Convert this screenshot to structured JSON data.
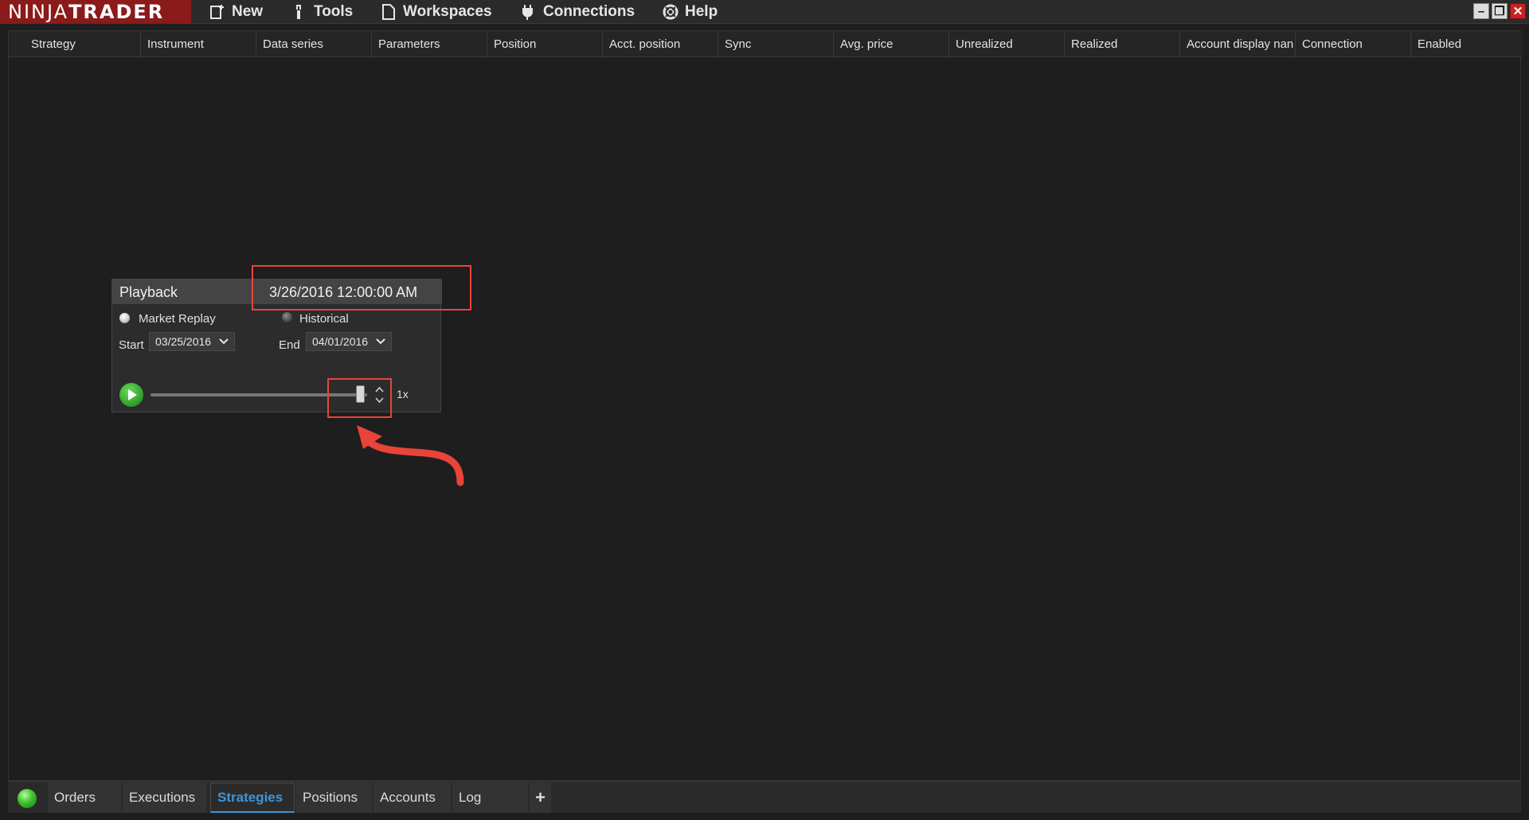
{
  "app": {
    "brand_a": "NINJA",
    "brand_b": "TRADER"
  },
  "menu": [
    {
      "label": "New",
      "icon": "new-window-icon"
    },
    {
      "label": "Tools",
      "icon": "wrench-icon"
    },
    {
      "label": "Workspaces",
      "icon": "document-icon"
    },
    {
      "label": "Connections",
      "icon": "plug-icon"
    },
    {
      "label": "Help",
      "icon": "lifebuoy-icon"
    }
  ],
  "window_controls": {
    "minimize": "–",
    "restore": "❐",
    "close": "✕"
  },
  "grid": {
    "columns": [
      "Strategy",
      "Instrument",
      "Data series",
      "Parameters",
      "Position",
      "Acct. position",
      "Sync",
      "Avg. price",
      "Unrealized",
      "Realized",
      "Account display nan",
      "Connection",
      "Enabled"
    ],
    "rows": []
  },
  "playback": {
    "title": "Playback",
    "current_time": "3/26/2016 12:00:00 AM",
    "mode_market_replay": "Market Replay",
    "mode_historical": "Historical",
    "selected_mode": "Market Replay",
    "start_label": "Start",
    "start_value": "03/25/2016",
    "end_label": "End",
    "end_value": "04/01/2016",
    "speed": "1x",
    "position_fraction": 0.97
  },
  "annotations": {
    "color": "#e8443a"
  },
  "bottom_tabs": [
    {
      "label": "Orders",
      "active": false
    },
    {
      "label": "Executions",
      "active": false
    },
    {
      "label": "Strategies",
      "active": true
    },
    {
      "label": "Positions",
      "active": false
    },
    {
      "label": "Accounts",
      "active": false
    },
    {
      "label": "Log",
      "active": false
    }
  ],
  "add_tab": "+",
  "colors": {
    "accent": "#3f95d8",
    "brand": "#8b1a1a",
    "connection_status": "#3ec02f"
  }
}
